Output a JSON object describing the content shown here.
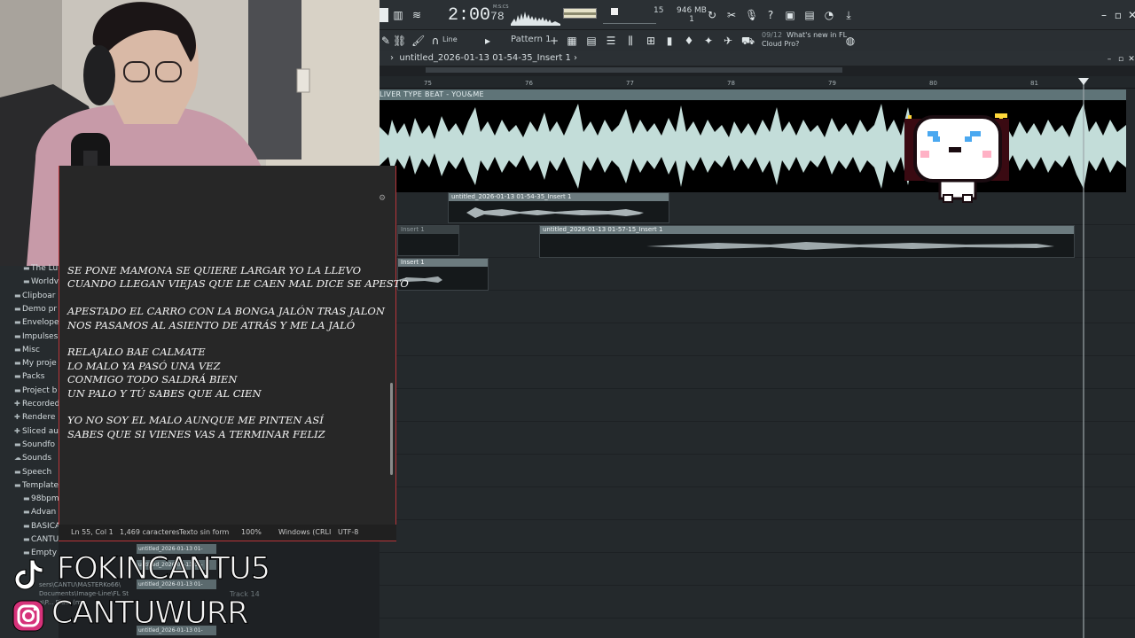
{
  "fl_studio": {
    "time_main": "2:00",
    "time_sub": "78",
    "time_unit": "M:S:CS",
    "tempo_value": "15",
    "memory": "946 MB",
    "cpu": "1",
    "toolbar": {
      "snap_label": "Line",
      "pattern_label": "Pattern 1",
      "news_count": "09/12",
      "news_line1": "What's new in FL",
      "news_line2": "Cloud Pro?"
    },
    "playlist": {
      "title": "untitled_2026-01-13 01-54-35_Insert 1",
      "ruler": [
        "75",
        "76",
        "77",
        "78",
        "79",
        "80",
        "81"
      ],
      "big_clip_name": "LIVER TYPE BEAT - YOU&ME",
      "clips": [
        {
          "name": "untitled_2026-01-13 01-54-35_Insert 1"
        },
        {
          "name": "Insert 1"
        },
        {
          "name": "untitled_2026-01-13 01-57-15_Insert 1"
        },
        {
          "name": "Insert 1"
        }
      ]
    }
  },
  "browser": {
    "items": [
      {
        "label": "The Lu",
        "icon": "folder-icon",
        "sub": true
      },
      {
        "label": "Worldv",
        "icon": "folder-icon",
        "sub": true
      },
      {
        "label": "Clipboar",
        "icon": "folder-icon",
        "sub": false
      },
      {
        "label": "Demo pr",
        "icon": "folder-icon",
        "sub": false
      },
      {
        "label": "Envelope",
        "icon": "folder-icon",
        "sub": false
      },
      {
        "label": "Impulses",
        "icon": "folder-icon",
        "sub": false
      },
      {
        "label": "Misc",
        "icon": "folder-icon",
        "sub": false
      },
      {
        "label": "My proje",
        "icon": "folder-icon",
        "sub": false
      },
      {
        "label": "Packs",
        "icon": "folder-icon",
        "sub": false
      },
      {
        "label": "Project b",
        "icon": "folder-icon",
        "sub": false
      },
      {
        "label": "Recorded",
        "icon": "plus-icon",
        "sub": false
      },
      {
        "label": "Rendere",
        "icon": "plus-icon",
        "sub": false
      },
      {
        "label": "Sliced au",
        "icon": "plus-icon",
        "sub": false
      },
      {
        "label": "Soundfo",
        "icon": "folder-icon",
        "sub": false
      },
      {
        "label": "Sounds",
        "icon": "cloud-icon",
        "sub": false
      },
      {
        "label": "Speech",
        "icon": "folder-icon",
        "sub": false
      },
      {
        "label": "Template",
        "icon": "folder-icon",
        "sub": false
      },
      {
        "label": "98bpm",
        "icon": "folder-icon",
        "sub": true
      },
      {
        "label": "Advan",
        "icon": "folder-icon",
        "sub": true
      },
      {
        "label": "BASICA",
        "icon": "folder-icon",
        "sub": true
      },
      {
        "label": "CANTU",
        "icon": "folder-icon",
        "sub": true
      },
      {
        "label": "Empty",
        "icon": "folder-icon",
        "sub": true
      }
    ]
  },
  "notepad": {
    "lyrics": "SE PONE MAMONA SE QUIERE LARGAR YO LA LLEVO\nCUANDO LLEGAN VIEJAS QUE LE CAEN MAL DICE SE APESTÓ\n\nAPESTADO EL CARRO CON LA BONGA JALÓN TRAS JALON\nNOS PASAMOS AL ASIENTO DE ATRÁS Y ME LA JALÓ\n\nRELAJALO BAE CALMATE\nLO MALO YA PASÓ UNA VEZ\nCONMIGO TODO SALDRÁ BIEN\nUN PALO Y TÚ SABES QUE AL CIEN\n\nYO NO SOY EL MALO AUNQUE ME PINTEN ASÍ\nSABES QUE SI VIENES VAS A TERMINAR FELIZ",
    "status": {
      "position": "Ln 55, Col 1",
      "chars": "1,469 caracteres",
      "format": "Texto sin form",
      "zoom": "100%",
      "eol": "Windows (CRLI",
      "encoding": "UTF-8"
    }
  },
  "overlay": {
    "tiktok_handle": "FOKINCANTU5",
    "instagram_handle": "CANTUWURR",
    "path_lines": [
      "sers\\CANTU\\MASTERKo66\\",
      "Documents\\Image-Line\\FL St",
      "a\\P... Plu... (m..."
    ],
    "bottom_clips": [
      "untitled_2026-01-13 01-",
      "untitled_2026-01-13 01-",
      "untitled_2026-01-13 01-",
      "untitled_2026-01-13 01-"
    ],
    "track_label": "Track 14"
  }
}
